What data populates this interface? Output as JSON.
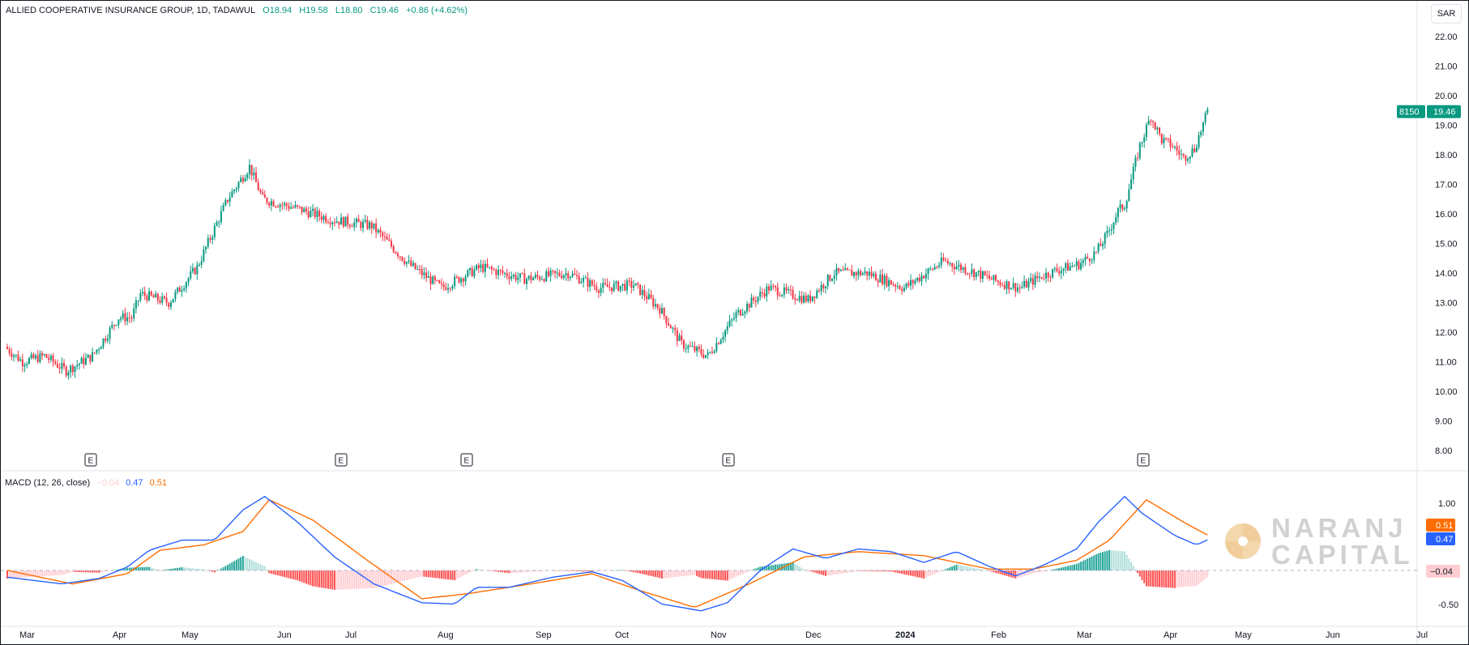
{
  "header": {
    "symbol": "ALLIED COOPERATIVE INSURANCE GROUP, 1D, TADAWUL",
    "open": "O18.94",
    "high": "H19.58",
    "low": "L18.80",
    "close": "C19.46",
    "change": "+0.86 (+4.62%)"
  },
  "currency": "SAR",
  "price_badge": {
    "ticker": "8150",
    "price": "19.46"
  },
  "macd_header": {
    "label": "MACD (12, 26, close)",
    "hist": "−0.04",
    "macd": "0.47",
    "signal": "0.51"
  },
  "macd_badges": {
    "signal": "0.51",
    "macd": "0.47",
    "hist": "−0.04"
  },
  "watermark": {
    "line1": "NARANJ",
    "line2": "CAPITAL"
  },
  "colors": {
    "up": "#089981",
    "down": "#f23645",
    "macd_line": "#2962ff",
    "signal_line": "#ff6d00",
    "hist_up_strong": "#26a69a",
    "hist_up_weak": "#b2dfdb",
    "hist_down_strong": "#ff5252",
    "hist_down_weak": "#ffcdd2"
  },
  "chart_data": {
    "type": "candlestick",
    "x_labels": [
      "Mar",
      "Apr",
      "May",
      "Jun",
      "Jul",
      "Aug",
      "Sep",
      "Oct",
      "Nov",
      "Dec",
      "2024",
      "Feb",
      "Mar",
      "Apr",
      "May",
      "Jun",
      "Jul"
    ],
    "price_axis": {
      "ticks": [
        "22.00",
        "21.00",
        "20.00",
        "19.00",
        "18.00",
        "17.00",
        "16.00",
        "15.00",
        "14.00",
        "13.00",
        "12.00",
        "11.00",
        "10.00",
        "9.00",
        "8.00"
      ],
      "range": [
        7.5,
        22.5
      ]
    },
    "macd_axis": {
      "ticks": [
        "1.00",
        "-0.50"
      ],
      "range": [
        -0.95,
        1.45
      ]
    },
    "earnings_markers": [
      "E",
      "E",
      "E",
      "E",
      "E"
    ],
    "price_path": [
      [
        0,
        11.5
      ],
      [
        8,
        11.0
      ],
      [
        18,
        11.2
      ],
      [
        28,
        10.7
      ],
      [
        40,
        11.2
      ],
      [
        52,
        12.5
      ],
      [
        58,
        12.5
      ],
      [
        62,
        13.3
      ],
      [
        75,
        13.0
      ],
      [
        88,
        14.2
      ],
      [
        102,
        16.5
      ],
      [
        112,
        17.6
      ],
      [
        118,
        16.5
      ],
      [
        133,
        16.2
      ],
      [
        150,
        15.8
      ],
      [
        168,
        15.6
      ],
      [
        185,
        14.3
      ],
      [
        200,
        13.5
      ],
      [
        218,
        14.2
      ],
      [
        238,
        13.8
      ],
      [
        258,
        14.0
      ],
      [
        272,
        13.5
      ],
      [
        288,
        13.6
      ],
      [
        300,
        12.8
      ],
      [
        310,
        11.6
      ],
      [
        322,
        11.2
      ],
      [
        335,
        12.6
      ],
      [
        350,
        13.5
      ],
      [
        368,
        13.1
      ],
      [
        380,
        14.0
      ],
      [
        395,
        14.0
      ],
      [
        412,
        13.5
      ],
      [
        430,
        14.4
      ],
      [
        445,
        14.0
      ],
      [
        455,
        13.7
      ],
      [
        465,
        13.5
      ],
      [
        475,
        13.9
      ],
      [
        482,
        14.1
      ],
      [
        492,
        14.3
      ],
      [
        500,
        14.7
      ],
      [
        505,
        15.3
      ],
      [
        510,
        16.1
      ],
      [
        513,
        16.3
      ],
      [
        520,
        18.3
      ],
      [
        525,
        19.3
      ],
      [
        530,
        18.5
      ],
      [
        535,
        18.3
      ],
      [
        540,
        17.9
      ],
      [
        545,
        18.2
      ],
      [
        551,
        19.46
      ]
    ],
    "high_point": 19.58,
    "low_point": 10.5,
    "macd_path": [
      [
        0,
        -0.1
      ],
      [
        25,
        -0.2
      ],
      [
        42,
        -0.12
      ],
      [
        55,
        0.05
      ],
      [
        65,
        0.3
      ],
      [
        80,
        0.45
      ],
      [
        95,
        0.45
      ],
      [
        108,
        0.9
      ],
      [
        118,
        1.1
      ],
      [
        133,
        0.72
      ],
      [
        150,
        0.2
      ],
      [
        168,
        -0.2
      ],
      [
        190,
        -0.48
      ],
      [
        205,
        -0.5
      ],
      [
        215,
        -0.25
      ],
      [
        230,
        -0.25
      ],
      [
        250,
        -0.1
      ],
      [
        268,
        -0.02
      ],
      [
        282,
        -0.15
      ],
      [
        300,
        -0.5
      ],
      [
        318,
        -0.6
      ],
      [
        330,
        -0.48
      ],
      [
        345,
        0.0
      ],
      [
        360,
        0.32
      ],
      [
        375,
        0.18
      ],
      [
        390,
        0.32
      ],
      [
        405,
        0.28
      ],
      [
        420,
        0.12
      ],
      [
        435,
        0.28
      ],
      [
        450,
        0.06
      ],
      [
        462,
        -0.08
      ],
      [
        475,
        0.08
      ],
      [
        490,
        0.32
      ],
      [
        500,
        0.72
      ],
      [
        512,
        1.1
      ],
      [
        520,
        0.85
      ],
      [
        535,
        0.52
      ],
      [
        545,
        0.38
      ],
      [
        551,
        0.47
      ]
    ],
    "signal_path": [
      [
        0,
        0.0
      ],
      [
        30,
        -0.2
      ],
      [
        55,
        -0.05
      ],
      [
        70,
        0.3
      ],
      [
        90,
        0.38
      ],
      [
        108,
        0.58
      ],
      [
        120,
        1.05
      ],
      [
        140,
        0.75
      ],
      [
        165,
        0.15
      ],
      [
        190,
        -0.42
      ],
      [
        210,
        -0.35
      ],
      [
        240,
        -0.2
      ],
      [
        268,
        -0.05
      ],
      [
        290,
        -0.3
      ],
      [
        315,
        -0.55
      ],
      [
        340,
        -0.2
      ],
      [
        365,
        0.2
      ],
      [
        390,
        0.28
      ],
      [
        420,
        0.22
      ],
      [
        450,
        0.02
      ],
      [
        470,
        0.02
      ],
      [
        490,
        0.15
      ],
      [
        505,
        0.45
      ],
      [
        522,
        1.05
      ],
      [
        540,
        0.7
      ],
      [
        551,
        0.51
      ]
    ]
  }
}
